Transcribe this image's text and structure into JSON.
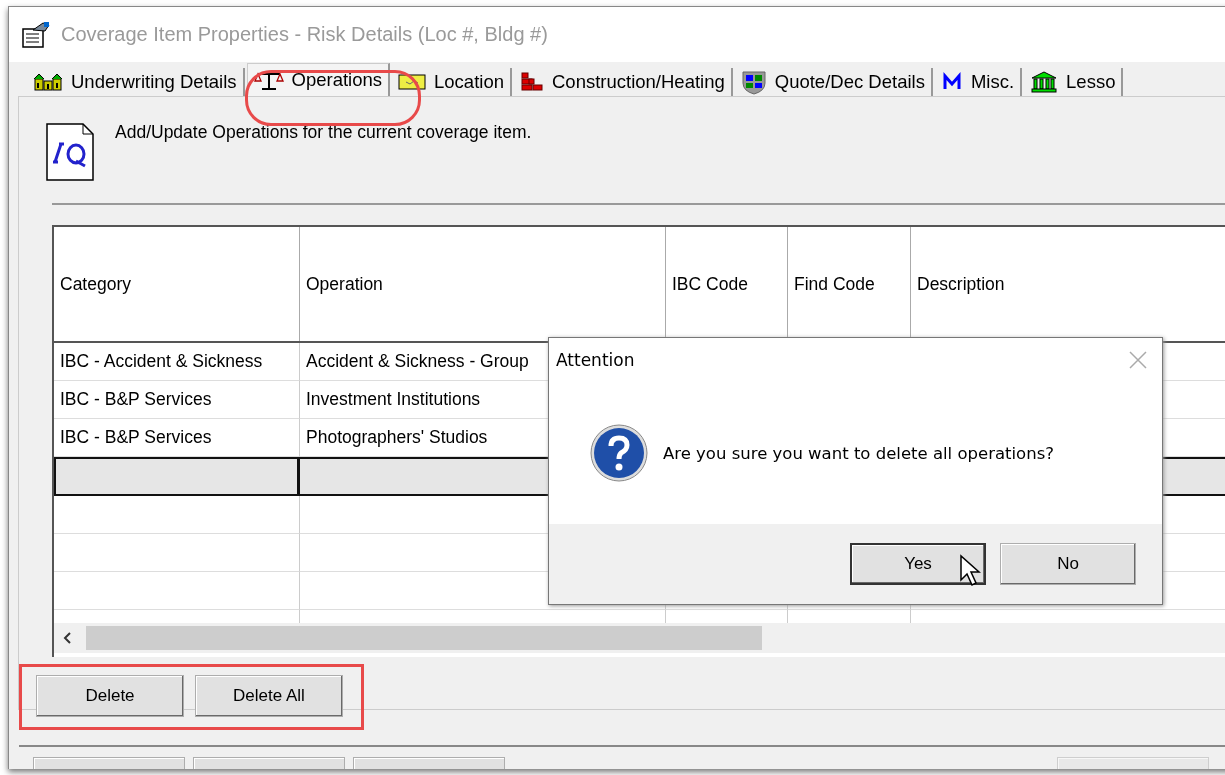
{
  "window": {
    "title": "Coverage Item Properties - Risk Details (Loc #, Bldg #)"
  },
  "tabs": [
    {
      "label": "Underwriting Details",
      "selected": false
    },
    {
      "label": "Operations",
      "selected": true
    },
    {
      "label": "Location",
      "selected": false
    },
    {
      "label": "Construction/Heating",
      "selected": false
    },
    {
      "label": "Quote/Dec Details",
      "selected": false
    },
    {
      "label": "Misc.",
      "selected": false
    },
    {
      "label": "Lesso",
      "selected": false
    }
  ],
  "panel": {
    "description": "Add/Update Operations for the current coverage item."
  },
  "table": {
    "columns": [
      "Category",
      "Operation",
      "IBC Code",
      "Find Code",
      "Description"
    ],
    "rows": [
      {
        "category": "IBC - Accident & Sickness",
        "operation": "Accident & Sickness - Group"
      },
      {
        "category": "IBC - B&P Services",
        "operation": "Investment Institutions"
      },
      {
        "category": "IBC - B&P Services",
        "operation": "Photographers' Studios"
      }
    ]
  },
  "buttons": [
    {
      "label": "Delete"
    },
    {
      "label": "Delete All"
    }
  ],
  "dialog": {
    "title": "Attention",
    "message": "Are you sure you want to delete all operations?",
    "buttons": [
      {
        "label": "Yes",
        "default": true
      },
      {
        "label": "No",
        "default": false
      }
    ]
  }
}
